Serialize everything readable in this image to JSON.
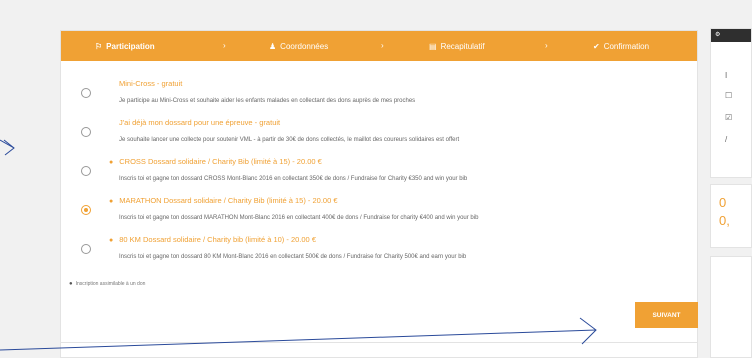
{
  "steps": [
    {
      "label": "Participation",
      "icon": "flag-icon",
      "glyph": "⚐"
    },
    {
      "label": "Coordonnées",
      "icon": "user-icon",
      "glyph": "♟"
    },
    {
      "label": "Recapitulatif",
      "icon": "list-icon",
      "glyph": "▤"
    },
    {
      "label": "Confirmation",
      "icon": "check-icon",
      "glyph": "✔"
    }
  ],
  "step_separator": "›",
  "options": [
    {
      "title": "Mini-Cross - gratuit",
      "desc": "Je participe au Mini-Cross et souhaite aider les enfants malades en collectant des dons auprès de mes proches",
      "selected": false,
      "tag": ""
    },
    {
      "title": "J'ai déjà mon dossard pour une épreuve - gratuit",
      "desc": "Je souhaite lancer une collecte pour soutenir VML - à partir de 30€ de dons collectés, le maillot des coureurs solidaires est offert",
      "selected": false,
      "tag": ""
    },
    {
      "title": "CROSS Dossard solidaire / Charity Bib (limité à 15) - 20.00 €",
      "desc": "Inscris toi et gagne ton dossard CROSS Mont-Blanc 2016 en collectant 350€ de dons / Fundraise for Charity €350 and win your bib",
      "selected": false,
      "tag": "●"
    },
    {
      "title": "MARATHON Dossard solidaire / Charity Bib (limité à 15) - 20.00 €",
      "desc": "Inscris toi et gagne ton dossard MARATHON Mont-Blanc 2016 en collectant 400€ de dons / Fundraise for charity €400 and win your bib",
      "selected": true,
      "tag": "●"
    },
    {
      "title": "80 KM Dossard solidaire / Charity bib (limité à 10) - 20.00 €",
      "desc": "Inscris toi et gagne ton dossard 80 KM Mont-Blanc 2016 en collectant 500€ de dons / Fundraise for Charity 500€ and earn your bib",
      "selected": false,
      "tag": "●"
    }
  ],
  "note": "Inscription assimilable à un don",
  "next_button": "SUIVANT",
  "sidebar": {
    "num1": "0",
    "num2": "0,"
  },
  "colors": {
    "accent": "#f0a134"
  }
}
